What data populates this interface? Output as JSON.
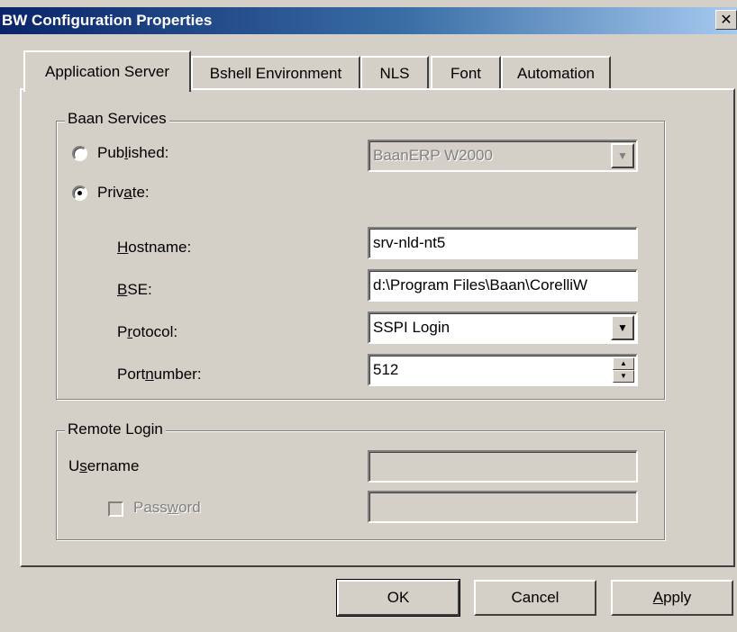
{
  "window": {
    "title": "BW Configuration Properties",
    "close_glyph": "✕"
  },
  "tabs": [
    {
      "label": "Application Server",
      "active": true
    },
    {
      "label": "Bshell Environment",
      "active": false
    },
    {
      "label": "NLS",
      "active": false
    },
    {
      "label": "Font",
      "active": false
    },
    {
      "label": "Automation",
      "active": false
    }
  ],
  "baan_services": {
    "group_label": "Baan Services",
    "published": {
      "label_pre": "Pub",
      "label_u": "l",
      "label_post": "ished:",
      "selected": false
    },
    "published_value": "BaanERP W2000",
    "private": {
      "label_pre": "Priv",
      "label_u": "a",
      "label_post": "te:",
      "selected": true
    },
    "hostname": {
      "label_u": "H",
      "label_post": "ostname:",
      "value": "srv-nld-nt5"
    },
    "bse": {
      "label_u": "B",
      "label_post": "SE:",
      "value": "d:\\Program Files\\Baan\\CorelliW"
    },
    "protocol": {
      "label_pre": "P",
      "label_u": "r",
      "label_post": "otocol:",
      "value": "SSPI Login"
    },
    "portnumber": {
      "label_pre": "Port",
      "label_u": "n",
      "label_post": "umber:",
      "value": "512"
    }
  },
  "remote_login": {
    "group_label": "Remote Login",
    "username": {
      "label_pre": "U",
      "label_u": "s",
      "label_post": "ername",
      "value": ""
    },
    "password": {
      "label_pre": "Pass",
      "label_u": "w",
      "label_post": "ord",
      "checked": false,
      "value": ""
    }
  },
  "buttons": {
    "ok": "OK",
    "cancel": "Cancel",
    "apply_u": "A",
    "apply_post": "pply"
  },
  "icons": {
    "dropdown_glyph": "▼",
    "spin_up_glyph": "▲",
    "spin_down_glyph": "▼"
  },
  "colors": {
    "face": "#d4d0c8",
    "title_start": "#0a246a",
    "title_end": "#a6caf0",
    "disabled_text": "#808080"
  }
}
